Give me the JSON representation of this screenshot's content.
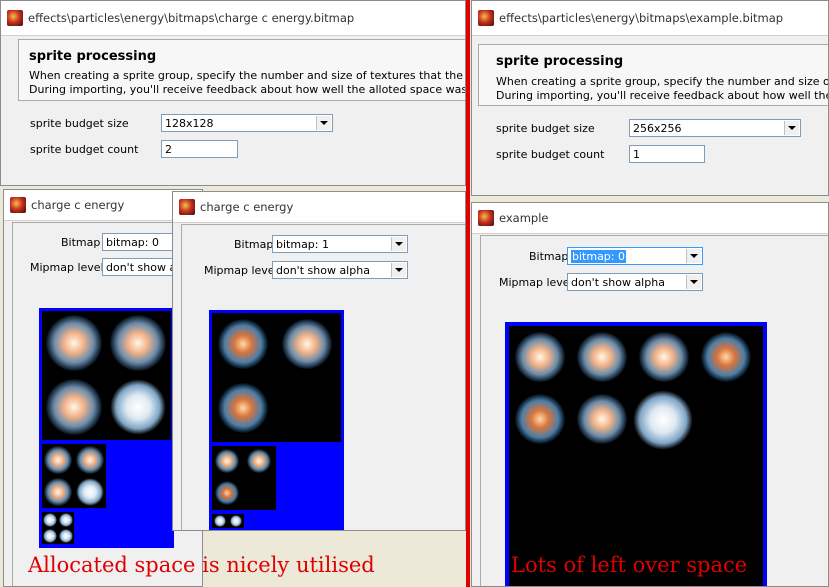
{
  "left_panel": {
    "path": "effects\\particles\\energy\\bitmaps\\charge c energy.bitmap",
    "section_title": "sprite processing",
    "desc_line1": "When creating a sprite group, specify the number and size of textures that the group is allowe",
    "desc_line2": "During importing, you'll receive feedback about how well the alloted space was used.",
    "budget_size_label": "sprite budget size",
    "budget_size_value": "128x128",
    "budget_count_label": "sprite budget count",
    "budget_count_value": "2"
  },
  "right_panel": {
    "path": "effects\\particles\\energy\\bitmaps\\example.bitmap",
    "section_title": "sprite processing",
    "desc_line1": "When creating a sprite group, specify the number and size of textures th",
    "desc_line2": "During importing, you'll receive feedback about how well the alloted spa",
    "budget_size_label": "sprite budget size",
    "budget_size_value": "256x256",
    "budget_count_label": "sprite budget count",
    "budget_count_value": "1"
  },
  "viewer1": {
    "title": "charge c energy",
    "bitmap_label": "Bitmap",
    "bitmap_value": "bitmap: 0",
    "mipmap_label": "Mipmap level",
    "mipmap_value": "don't show alp"
  },
  "viewer2": {
    "title": "charge c energy",
    "bitmap_label": "Bitmap",
    "bitmap_value": "bitmap: 1",
    "mipmap_label": "Mipmap level",
    "mipmap_value": "don't show alpha"
  },
  "viewer3": {
    "title": "example",
    "bitmap_label": "Bitmap",
    "bitmap_value": "bitmap: 0",
    "mipmap_label": "Mipmap level",
    "mipmap_value": "don't show alpha"
  },
  "captions": {
    "left": "Allocated space is nicely utilised",
    "right": "Lots of left over space"
  },
  "colors": {
    "annotation": "#e00000",
    "bitmap_background": "#0000ff",
    "sprite_sheet": "#000000"
  },
  "icons": {
    "window": "flame-app-icon",
    "dropdown": "chevron-down-icon"
  }
}
